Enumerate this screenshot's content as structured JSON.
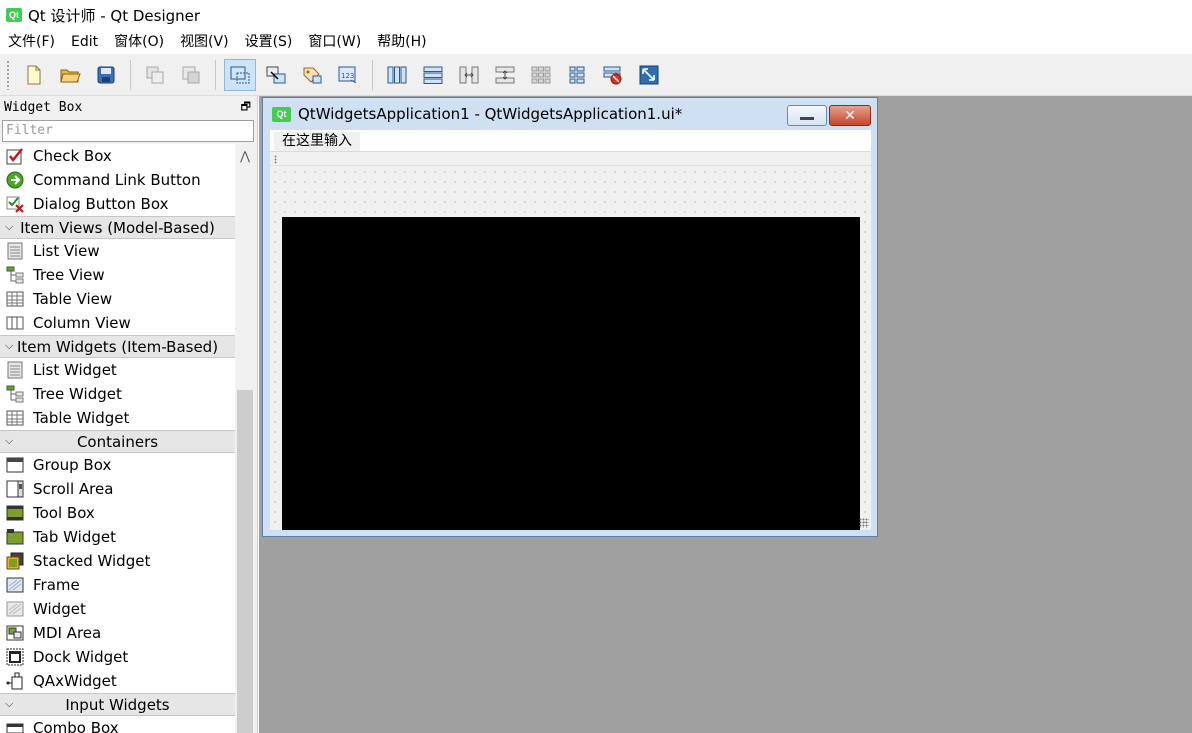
{
  "window": {
    "title": "Qt 设计师 - Qt Designer",
    "logo": "Qt"
  },
  "menu": [
    "文件(F)",
    "Edit",
    "窗体(O)",
    "视图(V)",
    "设置(S)",
    "窗口(W)",
    "帮助(H)"
  ],
  "toolbar": {
    "file": [
      "new-file-icon",
      "open-folder-icon",
      "save-icon"
    ],
    "edit": [
      "copy-icon",
      "paste-icon"
    ],
    "mode": [
      "edit-widgets-icon",
      "edit-signals-slots-icon",
      "edit-buddies-icon",
      "edit-tab-order-icon"
    ],
    "layout": [
      "layout-horizontal-icon",
      "layout-vertical-icon",
      "layout-h-splitter-icon",
      "layout-v-splitter-icon",
      "layout-grid-icon",
      "layout-form-icon",
      "break-layout-icon",
      "adjust-size-icon"
    ]
  },
  "widget_box": {
    "title": "Widget Box",
    "filter_placeholder": "Filter",
    "rows": [
      {
        "type": "item",
        "label": "Check Box",
        "icon": "check-box-icon"
      },
      {
        "type": "item",
        "label": "Command Link Button",
        "icon": "command-link-icon"
      },
      {
        "type": "item",
        "label": "Dialog Button Box",
        "icon": "dialog-button-box-icon"
      },
      {
        "type": "category",
        "label": "Item Views (Model-Based)"
      },
      {
        "type": "item",
        "label": "List View",
        "icon": "list-view-icon"
      },
      {
        "type": "item",
        "label": "Tree View",
        "icon": "tree-view-icon"
      },
      {
        "type": "item",
        "label": "Table View",
        "icon": "table-view-icon"
      },
      {
        "type": "item",
        "label": "Column View",
        "icon": "column-view-icon"
      },
      {
        "type": "category",
        "label": "Item Widgets (Item-Based)"
      },
      {
        "type": "item",
        "label": "List Widget",
        "icon": "list-widget-icon"
      },
      {
        "type": "item",
        "label": "Tree Widget",
        "icon": "tree-widget-icon"
      },
      {
        "type": "item",
        "label": "Table Widget",
        "icon": "table-widget-icon"
      },
      {
        "type": "category",
        "label": "Containers"
      },
      {
        "type": "item",
        "label": "Group Box",
        "icon": "group-box-icon"
      },
      {
        "type": "item",
        "label": "Scroll Area",
        "icon": "scroll-area-icon"
      },
      {
        "type": "item",
        "label": "Tool Box",
        "icon": "tool-box-icon"
      },
      {
        "type": "item",
        "label": "Tab Widget",
        "icon": "tab-widget-icon"
      },
      {
        "type": "item",
        "label": "Stacked Widget",
        "icon": "stacked-widget-icon"
      },
      {
        "type": "item",
        "label": "Frame",
        "icon": "frame-icon"
      },
      {
        "type": "item",
        "label": "Widget",
        "icon": "widget-icon"
      },
      {
        "type": "item",
        "label": "MDI Area",
        "icon": "mdi-area-icon"
      },
      {
        "type": "item",
        "label": "Dock Widget",
        "icon": "dock-widget-icon"
      },
      {
        "type": "item",
        "label": "QAxWidget",
        "icon": "qaxwidget-icon"
      },
      {
        "type": "category",
        "label": "Input Widgets"
      },
      {
        "type": "item",
        "label": "Combo Box",
        "icon": "combo-box-icon"
      }
    ]
  },
  "form": {
    "title": "QtWidgetsApplication1 - QtWidgetsApplication1.ui*",
    "logo": "Qt",
    "menu_placeholder": "在这里输入",
    "close_glyph": "✕"
  }
}
